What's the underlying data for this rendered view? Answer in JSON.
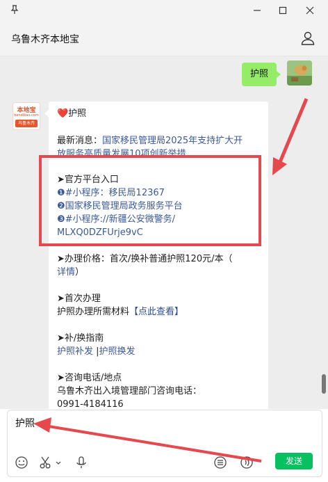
{
  "window": {
    "pin_icon": "pin-icon",
    "minimize_icon": "minimize-icon",
    "maximize_icon": "maximize-icon",
    "close_icon": "close-icon"
  },
  "header": {
    "title": "乌鲁木齐本地宝",
    "user_icon": "user-icon"
  },
  "outgoing": {
    "text": "护照"
  },
  "bot_avatar": {
    "logo_text": "本地宝",
    "logo_sub": "bendibao.com",
    "logo_city": "乌鲁木齐"
  },
  "message": {
    "title": "❤️护照",
    "news_label": "最新消息：",
    "news_link_1": "国家移民管理局2025年支持扩大开",
    "news_link_2": "放服务高质量发展10项创新举措",
    "official_heading": "➤官方平台入口",
    "official_item_1": "❶#小程序：移民局12367",
    "official_item_2": "❷国家移民管理局政务服务平台",
    "official_item_3a": "❸#小程序://新疆公安微警务/",
    "official_item_3b": "MLXQ0DZFUrje9vC",
    "price_line": "➤办理价格：首次/换补普通护照120元/本（",
    "price_detail": "详情",
    "price_close": "）",
    "first_heading": "➤首次办理",
    "first_text": "护照办理所需材料",
    "first_link": "【点此查看】",
    "replace_heading": "➤补/换指南",
    "replace_link_1": "护照补发",
    "replace_sep": "|",
    "replace_link_2": "护照换发",
    "contact_heading": "➤咨询电话/地点",
    "contact_text": "乌鲁木齐出入境管理部门咨询电话：",
    "contact_phone": "0991-4184116"
  },
  "composer": {
    "input_value": "护照",
    "send_label": "发送",
    "tools": [
      "emoji-icon",
      "scissors-icon",
      "microphone-icon",
      "list-icon",
      "voice-icon"
    ]
  },
  "colors": {
    "send_green": "#07c160",
    "outgoing_bubble": "#95ec69",
    "annotation_red": "#e5484d",
    "link_blue": "#3b5998"
  }
}
